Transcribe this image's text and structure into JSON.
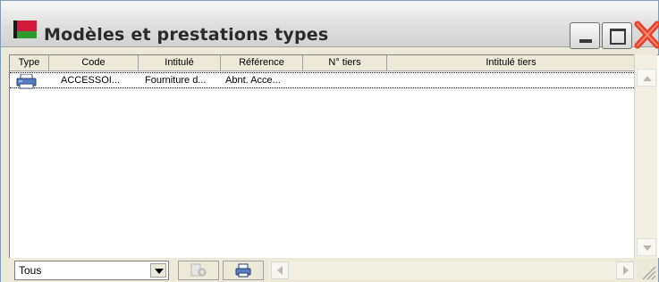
{
  "window": {
    "title": "Modèles et prestations types",
    "icon": "red-green-flag-icon",
    "controls": [
      "minimize-button",
      "maximize-button",
      "close-button"
    ]
  },
  "table": {
    "columns": [
      "Type",
      "Code",
      "Intitulé",
      "Référence",
      "N° tiers",
      "Intitulé tiers"
    ],
    "rows": [
      {
        "type_icon": "printer-icon",
        "code": "ACCESSOI...",
        "intitule": "Fourniture d...",
        "reference": "Abnt. Acce...",
        "n_tiers": "",
        "intitule_tiers": ""
      }
    ]
  },
  "footer": {
    "filter_value": "Tous",
    "icons": [
      "config-icon",
      "print-icon"
    ]
  },
  "colors": {
    "titlebar": "#e0e0e0",
    "close_button": "#e8402a",
    "header_bg": "#ece9d8"
  }
}
